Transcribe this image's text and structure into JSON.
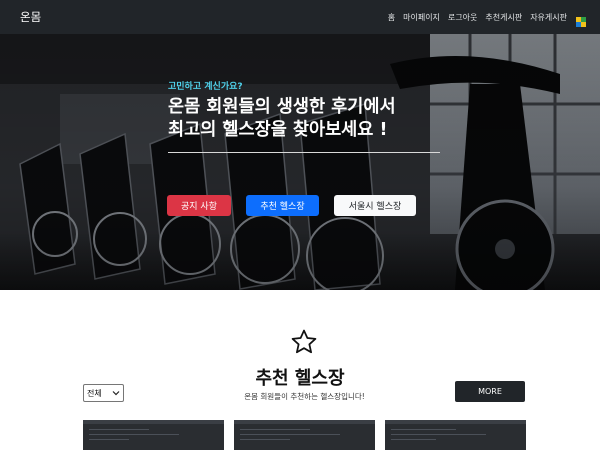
{
  "nav": {
    "brand": "온몸",
    "links": [
      "홈",
      "마이페이지",
      "로그아웃",
      "추천게시판",
      "자유게시판"
    ]
  },
  "hero": {
    "subtitle": "고민하고 계신가요?",
    "title_line1": "온몸 회원들의 생생한 후기에서",
    "title_line2": "최고의 헬스장을 찾아보세요 !",
    "buttons": {
      "notice": "공지 사항",
      "recommend": "추천 헬스장",
      "seoul": "서울시 헬스장"
    }
  },
  "section": {
    "title": "추천 헬스장",
    "description": "온몸 회원들이 추천하는 헬스장입니다!",
    "filter_selected": "전체",
    "more_label": "MORE"
  },
  "colors": {
    "navbar": "#212529",
    "hero_subtitle": "#4fd1ea",
    "btn_danger": "#dc3545",
    "btn_primary": "#0d6efd",
    "btn_light": "#f8f9fa",
    "btn_dark": "#212529"
  },
  "icons": {
    "star": "star-outline-icon",
    "flag": "flag-icon",
    "select_chevron": "chevron-down-icon"
  }
}
